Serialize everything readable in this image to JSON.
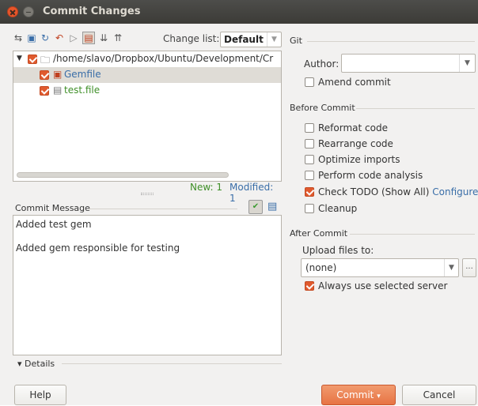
{
  "window": {
    "title": "Commit Changes"
  },
  "toolbar": {
    "change_list_label": "Change list:",
    "change_list_value": "Default"
  },
  "tree": {
    "root": "/home/slavo/Dropbox/Ubuntu/Development/Cr",
    "files": [
      {
        "name": "Gemfile",
        "color": "#3a6ea8"
      },
      {
        "name": "test.file",
        "color": "#3f8f28"
      }
    ]
  },
  "stats": {
    "new": "New: 1",
    "modified": "Modified: 1"
  },
  "commit_message": {
    "label": "Commit Message",
    "lines": [
      "Added test gem",
      "",
      "Added gem responsible for testing"
    ]
  },
  "details_label": "Details",
  "buttons": {
    "help": "Help",
    "commit": "Commit",
    "cancel": "Cancel"
  },
  "git": {
    "section": "Git",
    "author_label": "Author:",
    "author_value": "",
    "amend_label": "Amend commit"
  },
  "before_commit": {
    "section": "Before Commit",
    "options": [
      {
        "label": "Reformat code",
        "checked": false
      },
      {
        "label": "Rearrange code",
        "checked": false
      },
      {
        "label": "Optimize imports",
        "checked": false
      },
      {
        "label": "Perform code analysis",
        "checked": false
      },
      {
        "label": "Check TODO (Show All)",
        "checked": true,
        "link": "Configure"
      },
      {
        "label": "Cleanup",
        "checked": false
      }
    ]
  },
  "after_commit": {
    "section": "After Commit",
    "upload_label": "Upload files to:",
    "upload_value": "(none)",
    "more_label": "...",
    "always_label": "Always use selected server",
    "always_checked": true
  },
  "colors": {
    "accent": "#e05a2e",
    "link": "#3a6ea8",
    "new": "#3f8f28"
  }
}
